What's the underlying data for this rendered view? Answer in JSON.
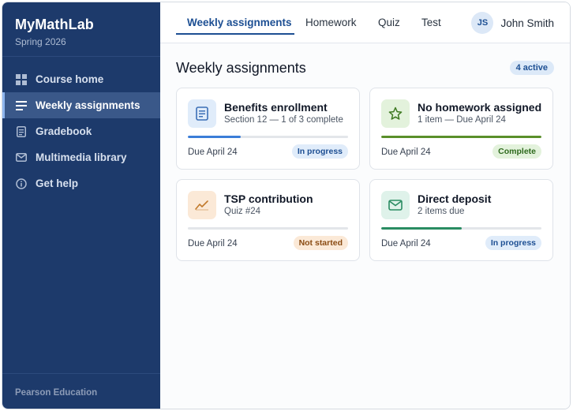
{
  "sidebar": {
    "brand_title": "MyMathLab",
    "brand_sub": "Spring 2026",
    "items": [
      {
        "label": "Course home",
        "icon": "grid-icon"
      },
      {
        "label": "Weekly assignments",
        "icon": "list-icon"
      },
      {
        "label": "Gradebook",
        "icon": "document-icon"
      },
      {
        "label": "Multimedia library",
        "icon": "envelope-icon"
      },
      {
        "label": "Get help",
        "icon": "info-icon"
      }
    ],
    "footer": "Pearson Education"
  },
  "topbar": {
    "tabs": [
      "Weekly assignments",
      "Homework",
      "Quiz",
      "Test"
    ],
    "user": {
      "initials": "JS",
      "name": "John Smith"
    }
  },
  "main": {
    "title": "Weekly assignments",
    "active_count": "4 active",
    "cards": [
      {
        "title": "Benefits enrollment",
        "sub": "Section 12 — 1 of 3 complete",
        "due": "Due April 24",
        "status": "In progress",
        "progress": 0.33,
        "icon": "document-icon"
      },
      {
        "title": "No homework assigned",
        "sub": "1 item — Due April 24",
        "due": "Due April 24",
        "status": "Complete",
        "progress": 1.0,
        "icon": "star-icon"
      },
      {
        "title": "TSP contribution",
        "sub": "Quiz #24",
        "due": "Due April 24",
        "status": "Not started",
        "progress": 0.0,
        "icon": "chart-line-icon"
      },
      {
        "title": "Direct deposit",
        "sub": "2 items due",
        "due": "Due April 24",
        "status": "In progress",
        "progress": 0.5,
        "icon": "envelope-icon"
      }
    ]
  },
  "colors": {
    "sidebar_bg": "#1d3a6b",
    "accent": "#1d4f93",
    "progress_blue": "#3b7dd8",
    "progress_green": "#5a8f2a",
    "progress_teal": "#2a8c62"
  }
}
